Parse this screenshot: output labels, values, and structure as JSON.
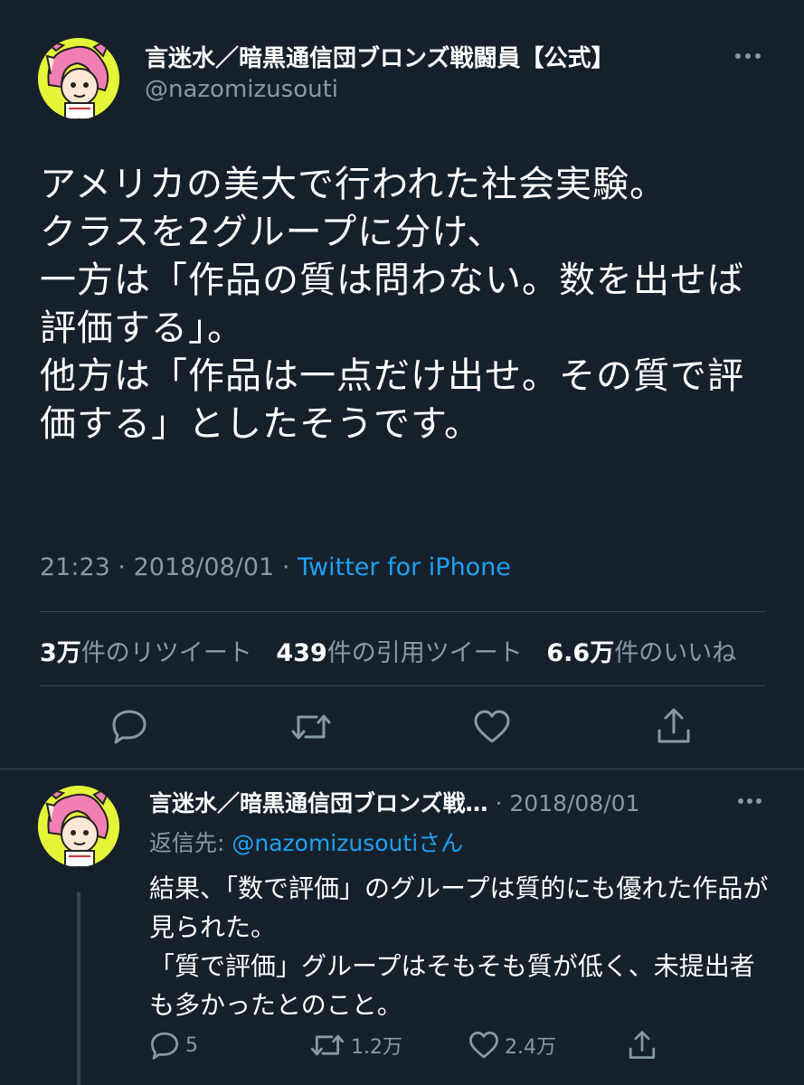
{
  "main_tweet": {
    "author_name": "言迷水／暗黒通信団ブロンズ戦闘員【公式】",
    "author_handle": "@nazomizusouti",
    "text": "アメリカの美大で行われた社会実験。\nクラスを2グループに分け、\n一方は「作品の質は問わない。数を出せば評価する」。\n他方は「作品は一点だけ出せ。その質で評価する」としたそうです。",
    "time": "21:23",
    "date": "2018/08/01",
    "separator": "·",
    "source": "Twitter for iPhone",
    "stats": {
      "retweets_num": "3万",
      "retweets_label": "件のリツイート",
      "quotes_num": "439",
      "quotes_label": "件の引用ツイート",
      "likes_num": "6.6万",
      "likes_label": "件のいいね"
    }
  },
  "reply": {
    "author_name": "言迷水／暗黒通信団ブロンズ戦…",
    "date": "· 2018/08/01",
    "reply_to_label": "返信先: ",
    "reply_to_handle": "@nazomizusouti",
    "reply_to_suffix": "さん",
    "text": "結果、「数で評価」のグループは質的にも優れた作品が見られた。\n「質で評価」グループはそもそも質が低く、未提出者も多かったとのこと。",
    "reply_count": "5",
    "retweet_count": "1.2万",
    "like_count": "2.4万"
  },
  "colors": {
    "background": "#15202b",
    "text_primary": "#ffffff",
    "text_secondary": "#8899a6",
    "accent": "#1da1f2",
    "divider": "#38444d",
    "avatar_bg": "#e4f53a"
  },
  "icons": {
    "more": "more-horizontal-icon",
    "reply": "reply-icon",
    "retweet": "retweet-icon",
    "like": "heart-icon",
    "share": "share-icon"
  }
}
